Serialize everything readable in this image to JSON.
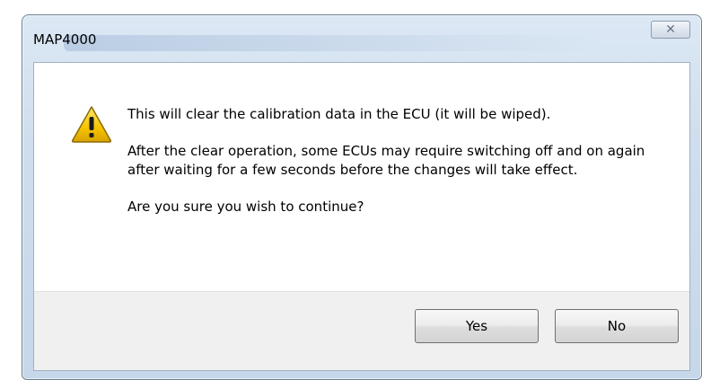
{
  "window": {
    "title": "MAP4000",
    "close_glyph": "✕"
  },
  "dialog": {
    "icon": "warning-icon",
    "message_line1": "This will clear the calibration data in the ECU (it will be wiped).",
    "message_line2": "After the clear operation, some ECUs may require switching off and on again after waiting for a few seconds before the changes will take effect.",
    "message_line3": "Are you sure you wish to continue?"
  },
  "buttons": {
    "yes_label": "Yes",
    "no_label": "No"
  },
  "colors": {
    "warning_yellow": "#f5c400",
    "title_gradient": "#cfdeee"
  }
}
